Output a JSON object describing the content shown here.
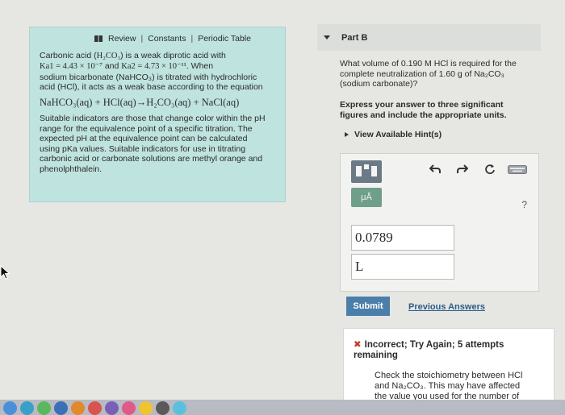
{
  "info": {
    "tabs": [
      "Review",
      "Constants",
      "Periodic Table"
    ],
    "separator": "|",
    "para1_line1_a": "Carbonic acid (",
    "para1_formula": "H₂CO₃",
    "para1_line1_b": ") is a weak diprotic acid with",
    "ka1": "Ka1 = 4.43 × 10⁻⁷",
    "and": " and ",
    "ka2": "Ka2 = 4.73 × 10⁻¹¹",
    "when": ". When",
    "para1_line3": "sodium bicarbonate (NaHCO₃) is titrated with hydrochloric",
    "para1_line4": "acid (HCl), it acts as a weak base according to the equation",
    "equation": "NaHCO₃(aq) + HCl(aq)→H₂CO₃(aq) + NaCl(aq)",
    "para2": [
      "Suitable indicators are those that change color within the pH",
      "range for the equivalence point of a specific titration. The",
      "expected pH at the equivalence point can be calculated",
      "using pKa values. Suitable indicators for use in titrating",
      "carbonic acid or carbonate solutions are methyl orange and",
      "phenolphthalein."
    ]
  },
  "part": {
    "label": "Part B"
  },
  "question": {
    "lines": [
      "What volume of 0.190 M HCl is required for the",
      "complete neutralization of 1.60 g of Na₂CO₃",
      "(sodium carbonate)?"
    ]
  },
  "instruction": {
    "lines": [
      "Express your answer to three significant",
      "figures and include the appropriate units."
    ]
  },
  "hint": {
    "label": "View Available Hint(s)"
  },
  "answer": {
    "mu_label": "μÅ",
    "help": "?",
    "value": "0.0789",
    "unit": "L"
  },
  "actions": {
    "submit": "Submit",
    "previous": "Previous Answers"
  },
  "feedback": {
    "title_line1": "Incorrect; Try Again; 5 attempts",
    "title_line2": "remaining",
    "body_line1": "Check the stoichiometry between HCl",
    "body_line2": "and Na₂CO₃. This may have affected",
    "body_line3": "the value you used for the number of"
  },
  "colors": {
    "info_bg": "#bfe3df",
    "submit_bg": "#4b7faa",
    "error": "#c0392b",
    "link": "#2c5b8a"
  }
}
